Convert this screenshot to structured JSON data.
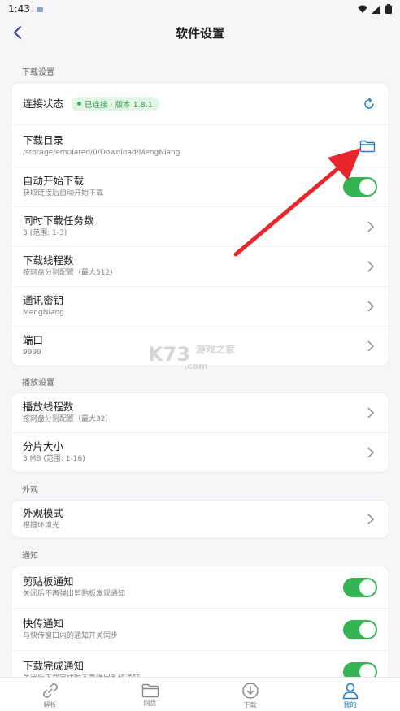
{
  "status_bar": {
    "time": "1:43"
  },
  "header": {
    "title": "软件设置"
  },
  "sections": {
    "download": {
      "title": "下载设置",
      "connection": {
        "title": "连接状态",
        "badge": "已连接 · 版本 1.8.1"
      },
      "directory": {
        "title": "下载目录",
        "value": "/storage/emulated/0/Download/MengNiang"
      },
      "auto_start": {
        "title": "自动开始下载",
        "subtitle": "获取链接后自动开始下载",
        "enabled": true
      },
      "concurrent": {
        "title": "同时下载任务数",
        "subtitle": "3 (范围: 1-3)"
      },
      "threads": {
        "title": "下载线程数",
        "subtitle": "按网盘分别配置（最大512）"
      },
      "secret": {
        "title": "通讯密钥",
        "subtitle": "MengNiang"
      },
      "port": {
        "title": "端口",
        "subtitle": "9999"
      }
    },
    "playback": {
      "title": "播放设置",
      "threads": {
        "title": "播放线程数",
        "subtitle": "按网盘分别配置（最大32）"
      },
      "chunk": {
        "title": "分片大小",
        "subtitle": "3 MB (范围: 1-16)"
      }
    },
    "appearance": {
      "title": "外观",
      "mode": {
        "title": "外观模式",
        "subtitle": "根据环境光"
      }
    },
    "notify": {
      "title": "通知",
      "clipboard": {
        "title": "剪贴板通知",
        "subtitle": "关闭后不再弹出剪贴板发现通知",
        "enabled": true
      },
      "quick": {
        "title": "快传通知",
        "subtitle": "与快传窗口内的通知开关同步",
        "enabled": true
      },
      "complete": {
        "title": "下载完成通知",
        "subtitle": "关闭后下载完成时不再弹出系统通知",
        "enabled": true
      }
    }
  },
  "bottom_nav": [
    {
      "label": "解析",
      "icon": "link-icon",
      "active": false
    },
    {
      "label": "网盘",
      "icon": "folder-icon",
      "active": false
    },
    {
      "label": "下载",
      "icon": "download-icon",
      "active": false
    },
    {
      "label": "我的",
      "icon": "person-icon",
      "active": true
    }
  ],
  "watermark": {
    "main": "K73",
    "sub": "游戏之家",
    "domain": ".com"
  },
  "colors": {
    "accent": "#1e7bd6",
    "toggle_on": "#34b454",
    "arrow": "#e8262b"
  }
}
